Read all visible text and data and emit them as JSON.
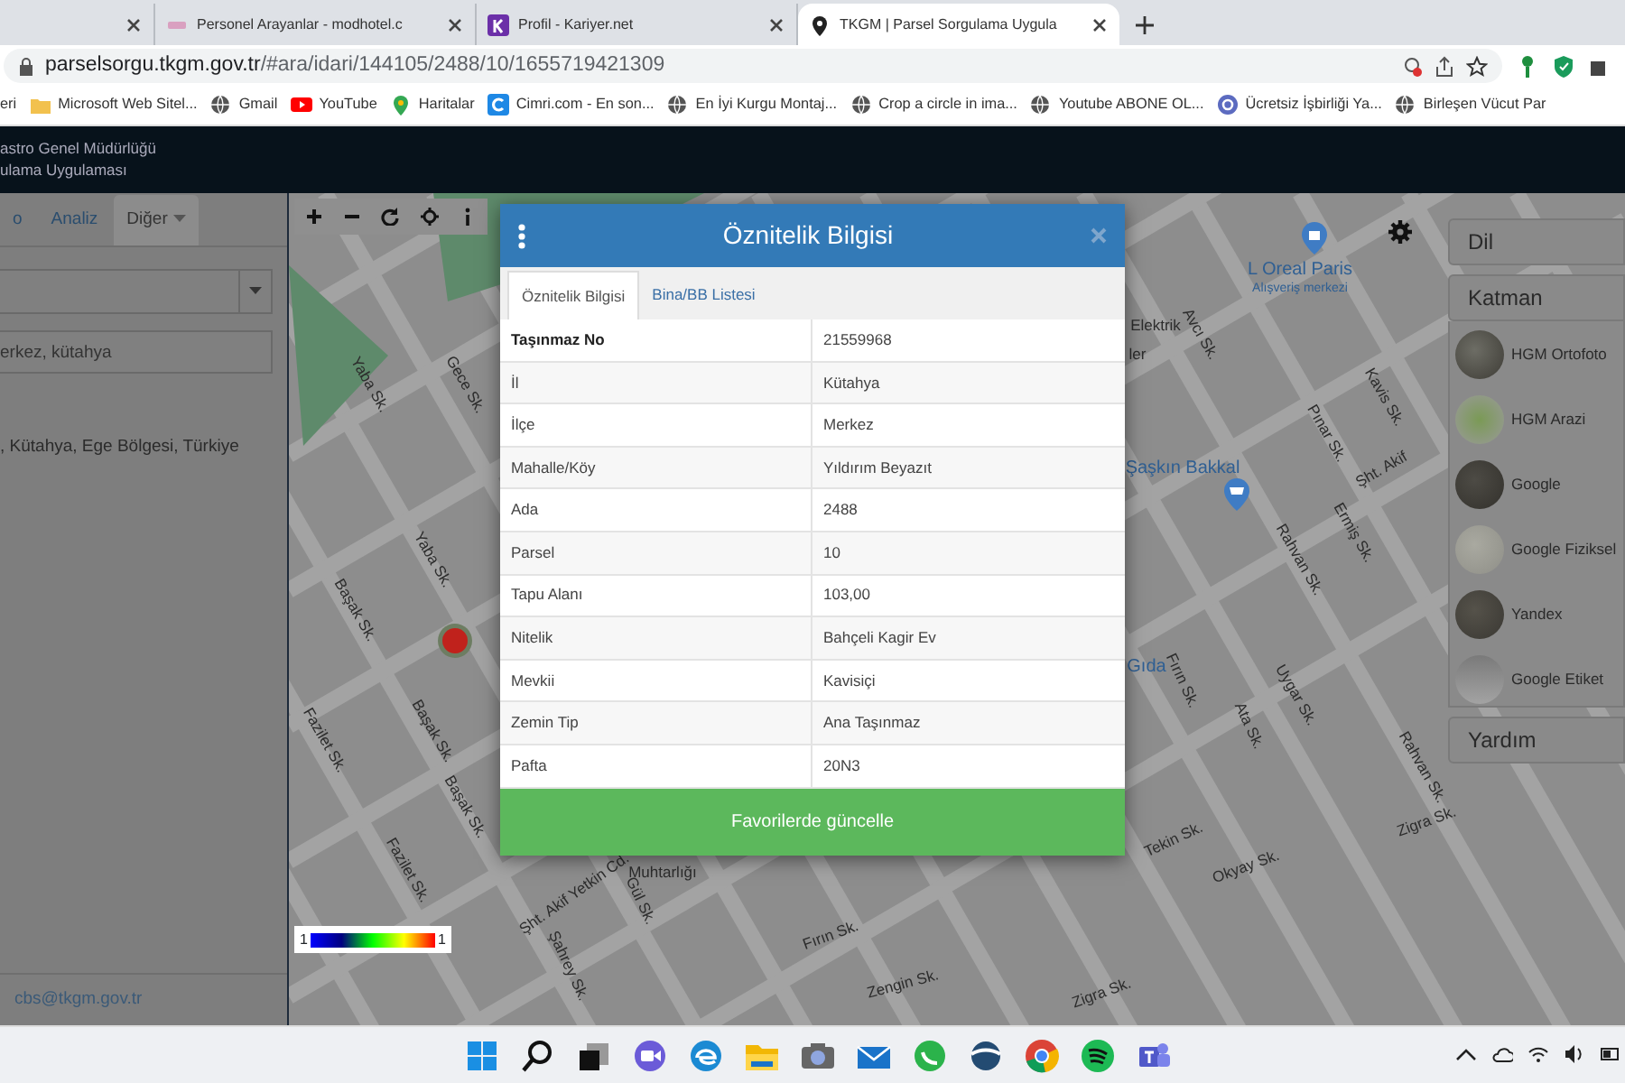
{
  "browser": {
    "tabs": [
      {
        "title": "Personel Arayanlar - modhotel.c",
        "selected": false
      },
      {
        "title": "Profil - Kariyer.net",
        "selected": false
      },
      {
        "title": "TKGM | Parsel Sorgulama Uygula",
        "selected": true
      }
    ],
    "address": {
      "host": "parselsorgu.tkgm.gov.tr",
      "path": "/#ara/idari/144105/2488/10/1655719421309"
    },
    "bookmarks": [
      "eri",
      "Microsoft Web Sitel...",
      "Gmail",
      "YouTube",
      "Haritalar",
      "Cimri.com - En son...",
      "En İyi Kurgu Montaj...",
      "Crop a circle in ima...",
      "Youtube ABONE OL...",
      "Ücretsiz İşbirliği Ya...",
      "Birleşen Vücut Par"
    ]
  },
  "app_header": {
    "lines": [
      "astro Genel Müdürlüğü",
      "ulama Uygulaması"
    ]
  },
  "sidebar": {
    "tabs": [
      {
        "label": "o",
        "selected": false
      },
      {
        "label": "Analiz",
        "selected": false
      },
      {
        "label": "Diğer",
        "selected": true
      }
    ],
    "search_value": "erkez, kütahya",
    "result": ", Kütahya, Ege Bölgesi, Türkiye",
    "footer": "cbs@tkgm.gov.tr"
  },
  "map": {
    "labels": [
      {
        "text": "Yaba Sk.",
        "kind": "street"
      },
      {
        "text": "Gece Sk.",
        "kind": "street"
      },
      {
        "text": "Yaba Sk.",
        "kind": "street"
      },
      {
        "text": "Başak Sk.",
        "kind": "street"
      },
      {
        "text": "Başak Sk.",
        "kind": "street"
      },
      {
        "text": "Fazilet Sk.",
        "kind": "street"
      },
      {
        "text": "Fazilet Sk.",
        "kind": "street"
      },
      {
        "text": "Başak Sk.",
        "kind": "street"
      },
      {
        "text": "Şht. Akif Yetkin Cd.",
        "kind": "street"
      },
      {
        "text": "Gül Sk.",
        "kind": "street"
      },
      {
        "text": "Şahrey Sk.",
        "kind": "street"
      },
      {
        "text": "Muhtarlığı",
        "kind": "place"
      },
      {
        "text": "Fırın Sk.",
        "kind": "street"
      },
      {
        "text": "Zengin Sk.",
        "kind": "street"
      },
      {
        "text": "Tekin Sk.",
        "kind": "street"
      },
      {
        "text": "Okyay Sk.",
        "kind": "street"
      },
      {
        "text": "Zigra Sk.",
        "kind": "street"
      },
      {
        "text": "Zigra Sk.",
        "kind": "street"
      },
      {
        "text": "Elektrik",
        "kind": "place"
      },
      {
        "text": "ler",
        "kind": "place"
      },
      {
        "text": "Avcı Sk.",
        "kind": "street"
      },
      {
        "text": "L Oreal Paris",
        "kind": "poi"
      },
      {
        "text": "Alışveriş merkezi",
        "kind": "poi-sub"
      },
      {
        "text": "Kavis Sk.",
        "kind": "street"
      },
      {
        "text": "Pınar Sk.",
        "kind": "street"
      },
      {
        "text": "Şht. Akif",
        "kind": "street"
      },
      {
        "text": "Şaşkın Bakkal",
        "kind": "poi"
      },
      {
        "text": "Ermiş Sk.",
        "kind": "street"
      },
      {
        "text": "Rahvan Sk.",
        "kind": "street"
      },
      {
        "text": "Gıda",
        "kind": "poi"
      },
      {
        "text": "Fırın Sk.",
        "kind": "street"
      },
      {
        "text": "Uygar Sk.",
        "kind": "street"
      },
      {
        "text": "Ata Sk.",
        "kind": "street"
      },
      {
        "text": "Rahvan Sk.",
        "kind": "street"
      }
    ],
    "legend": {
      "min": "1",
      "max": "1"
    }
  },
  "dialog": {
    "title": "Öznitelik Bilgisi",
    "tabs": [
      {
        "label": "Öznitelik Bilgisi",
        "selected": true
      },
      {
        "label": "Bina/BB Listesi",
        "selected": false
      }
    ],
    "rows": [
      {
        "label": "Taşınmaz No",
        "value": "21559968",
        "bold": true
      },
      {
        "label": "İl",
        "value": "Kütahya",
        "bold": false
      },
      {
        "label": "İlçe",
        "value": "Merkez",
        "bold": false
      },
      {
        "label": "Mahalle/Köy",
        "value": "Yıldırım Beyazıt",
        "bold": false
      },
      {
        "label": "Ada",
        "value": "2488",
        "bold": false
      },
      {
        "label": "Parsel",
        "value": "10",
        "bold": false
      },
      {
        "label": "Tapu Alanı",
        "value": "103,00",
        "bold": false
      },
      {
        "label": "Nitelik",
        "value": "Bahçeli Kagir Ev",
        "bold": false
      },
      {
        "label": "Mevkii",
        "value": "Kavisiçi",
        "bold": false
      },
      {
        "label": "Zemin Tip",
        "value": "Ana Taşınmaz",
        "bold": false
      },
      {
        "label": "Pafta",
        "value": "20N3",
        "bold": false
      }
    ],
    "button": "Favorilerde güncelle"
  },
  "right_panel": {
    "language": "Dil",
    "layers_title": "Katman",
    "layers": [
      "HGM Ortofoto",
      "HGM Arazi",
      "Google",
      "Google Fiziksel",
      "Yandex",
      "Google Etiket"
    ],
    "help": "Yardım"
  }
}
